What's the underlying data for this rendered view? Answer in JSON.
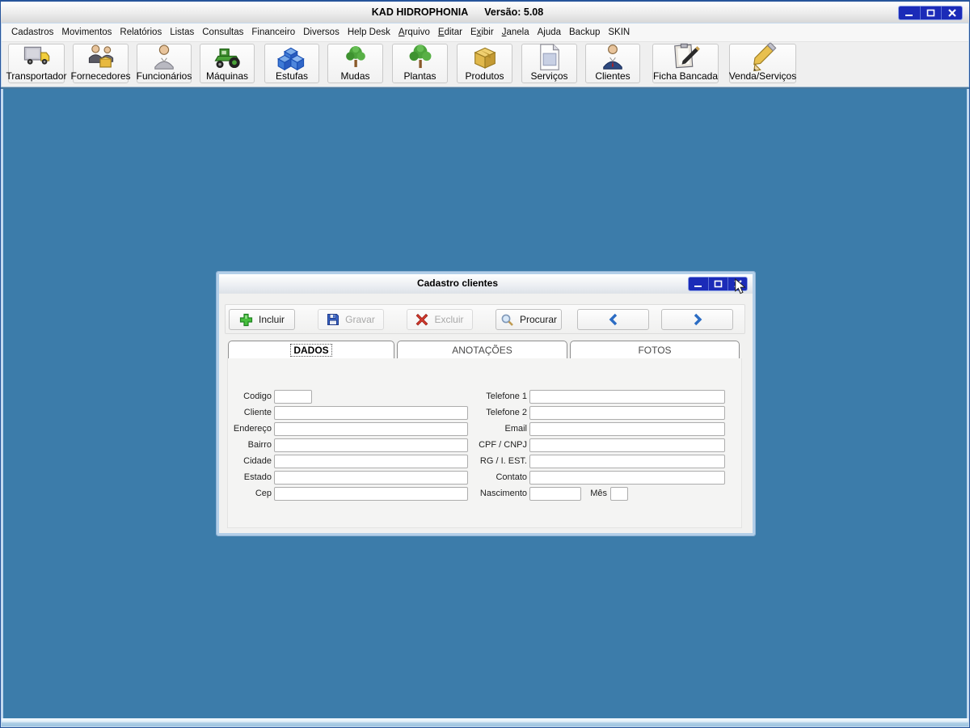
{
  "window": {
    "title": "KAD HIDROPHONIA",
    "version": "Versão: 5.08"
  },
  "menu": {
    "items": [
      {
        "label": "Cadastros"
      },
      {
        "label": "Movimentos"
      },
      {
        "label": "Relatórios"
      },
      {
        "label": "Listas"
      },
      {
        "label": "Consultas"
      },
      {
        "label": "Financeiro"
      },
      {
        "label": "Diversos"
      },
      {
        "label": "Help Desk"
      },
      {
        "label": "Arquivo",
        "accel_index": 0
      },
      {
        "label": "Editar",
        "accel_index": 0
      },
      {
        "label": "Exibir",
        "accel_index": 1
      },
      {
        "label": "Janela",
        "accel_index": 0
      },
      {
        "label": "Ajuda"
      },
      {
        "label": "Backup"
      },
      {
        "label": "SKIN"
      }
    ]
  },
  "toolbar": {
    "buttons": [
      {
        "label": "Transportador",
        "icon": "truck-icon"
      },
      {
        "label": "Fornecedores",
        "icon": "suppliers-icon"
      },
      {
        "label": "Funcionários",
        "icon": "employee-icon"
      },
      {
        "label": "Máquinas",
        "icon": "tractor-icon"
      },
      {
        "label": "Estufas",
        "icon": "cubes-icon"
      },
      {
        "label": "Mudas",
        "icon": "seedling-icon"
      },
      {
        "label": "Plantas",
        "icon": "plant-icon"
      },
      {
        "label": "Produtos",
        "icon": "box-icon"
      },
      {
        "label": "Serviços",
        "icon": "document-icon"
      },
      {
        "label": "Clientes",
        "icon": "client-icon"
      },
      {
        "label": "Ficha Bancada",
        "icon": "clipboard-icon"
      },
      {
        "label": "Venda/Serviços",
        "icon": "pencil-icon"
      }
    ]
  },
  "dialog": {
    "title": "Cadastro clientes",
    "toolbar_buttons": [
      {
        "label": "Incluir",
        "icon": "plus-icon",
        "enabled": true
      },
      {
        "label": "Gravar",
        "icon": "save-icon",
        "enabled": false
      },
      {
        "label": "Excluir",
        "icon": "delete-icon",
        "enabled": false
      },
      {
        "label": "Procurar",
        "icon": "search-icon",
        "enabled": true
      }
    ],
    "nav_buttons": [
      {
        "icon": "chevron-left-icon",
        "name": "previous-record-button"
      },
      {
        "icon": "chevron-right-icon",
        "name": "next-record-button"
      }
    ],
    "tabs": [
      {
        "label": "DADOS",
        "selected": true
      },
      {
        "label": "ANOTAÇÕES",
        "selected": false
      },
      {
        "label": "FOTOS",
        "selected": false
      }
    ],
    "form": {
      "left_rows": [
        {
          "label": "Codigo",
          "value": "",
          "small": true
        },
        {
          "label": "Cliente",
          "value": ""
        },
        {
          "label": "Endereço",
          "value": ""
        },
        {
          "label": "Bairro",
          "value": ""
        },
        {
          "label": "Cidade",
          "value": ""
        },
        {
          "label": "Estado",
          "value": ""
        },
        {
          "label": "Cep",
          "value": ""
        }
      ],
      "right_rows": [
        {
          "label": "Telefone 1",
          "value": ""
        },
        {
          "label": "Telefone 2",
          "value": ""
        },
        {
          "label": "Email",
          "value": ""
        },
        {
          "label": "CPF / CNPJ",
          "value": ""
        },
        {
          "label": "RG / I. EST.",
          "value": ""
        },
        {
          "label": "Contato",
          "value": ""
        },
        {
          "label": "Nascimento",
          "value": "",
          "small": true
        }
      ],
      "mes_label": "Mês",
      "mes_value": ""
    }
  }
}
